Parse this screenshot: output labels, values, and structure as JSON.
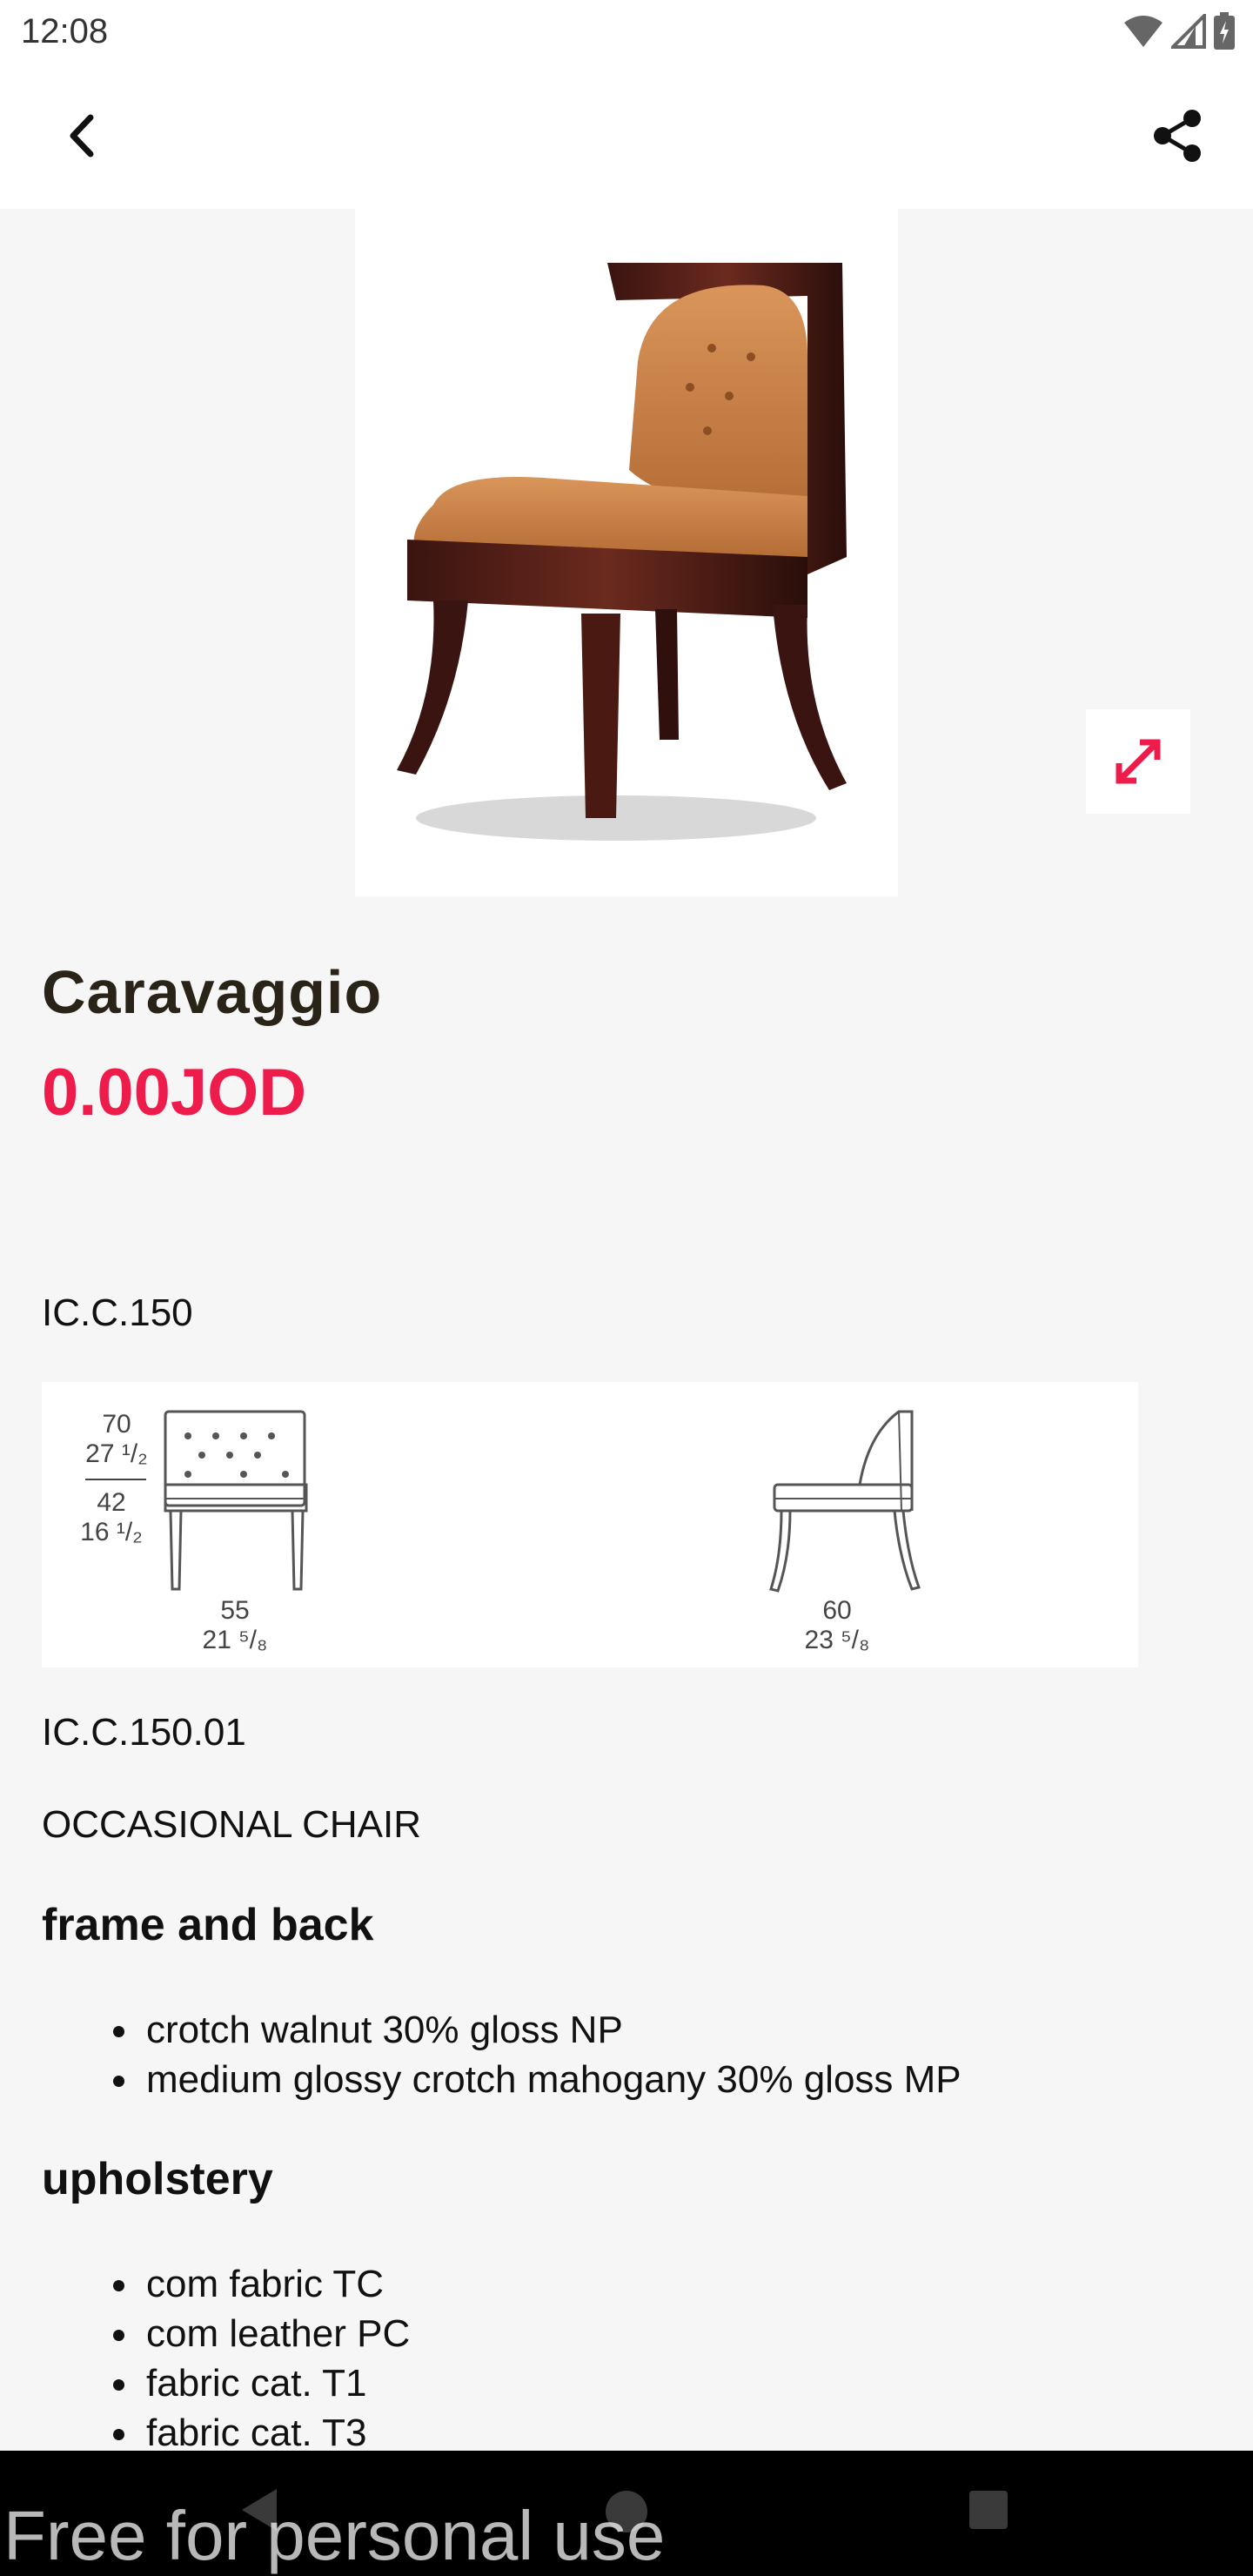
{
  "status_bar": {
    "time": "12:08"
  },
  "app_bar": {
    "back_icon": "back-arrow-icon",
    "share_icon": "share-icon"
  },
  "product": {
    "name": "Caravaggio",
    "price": "0.00JOD",
    "code": "IC.C.150",
    "sub_code": "IC.C.150.01",
    "type": "OCCASIONAL CHAIR"
  },
  "drawing": {
    "front_height_cm": "70",
    "front_height_in": "27 ¹/₂",
    "seat_height_cm": "42",
    "seat_height_in": "16 ¹/₂",
    "width_cm": "55",
    "width_in": "21 ⁵/₈",
    "depth_cm": "60",
    "depth_in": "23 ⁵/₈"
  },
  "sections": {
    "frame": {
      "title": "frame and back",
      "items": [
        "crotch walnut 30% gloss NP",
        "medium glossy crotch mahogany 30% gloss MP"
      ]
    },
    "upholstery": {
      "title": "upholstery",
      "items": [
        "com fabric TC",
        "com leather PC",
        "fabric cat. T1",
        "fabric cat. T3"
      ]
    }
  },
  "watermark": "Free for personal use",
  "colors": {
    "accent": "#ee1c4b",
    "title": "#2a2318",
    "background": "#f6f6f6"
  }
}
